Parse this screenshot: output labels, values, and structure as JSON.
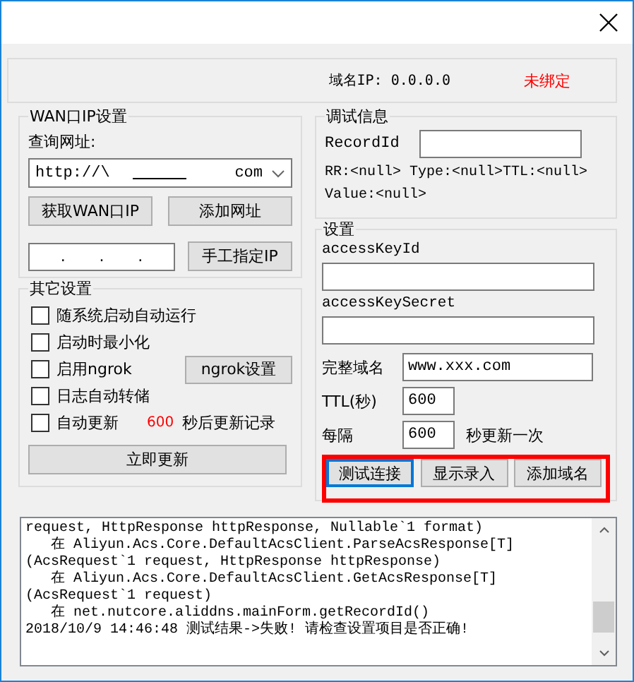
{
  "domain_ip": {
    "text": "域名IP: 0.0.0.0",
    "status": "未绑定"
  },
  "wan": {
    "title": "WAN口IP设置",
    "query_label": "查询网址:",
    "url_start": "http://\\",
    "url_end": "com",
    "buttons": [
      "获取WAN口IP",
      "添加网址"
    ],
    "ip_separators": [
      ".",
      ".",
      "."
    ],
    "manual_button": "手工指定IP"
  },
  "other": {
    "title": "其它设置",
    "options": [
      {
        "kind": "plain",
        "label": "随系统启动自动运行",
        "checked": false
      },
      {
        "kind": "plain",
        "label": "启动时最小化",
        "checked": false
      },
      {
        "kind": "button",
        "label": "启用ngrok",
        "checked": false,
        "button": "ngrok设置"
      },
      {
        "kind": "plain",
        "label": "日志自动转储",
        "checked": false
      },
      {
        "kind": "countdown",
        "label": "自动更新",
        "checked": false,
        "count": "600",
        "suffix": "秒后更新记录"
      }
    ],
    "update_button": "立即更新"
  },
  "debug": {
    "title": "调试信息",
    "record_label": "RecordId",
    "rr_line": "RR:<null> Type:<null>TTL:<null>",
    "value_line": "Value:<null>"
  },
  "settings": {
    "title": "设置",
    "rows": [
      {
        "kind": "stacked",
        "label": "accessKeyId"
      },
      {
        "kind": "stacked",
        "label": "accessKeySecret"
      },
      {
        "kind": "wide",
        "label": "完整域名",
        "value": "www.xxx.com"
      },
      {
        "kind": "short",
        "label": "TTL(秒)",
        "value": "600"
      },
      {
        "kind": "suffix",
        "label": "每隔",
        "value": "600",
        "suffix": "秒更新一次"
      }
    ],
    "buttons": [
      {
        "label": "测试连接",
        "focused": true
      },
      {
        "label": "显示录入",
        "focused": false
      },
      {
        "label": "添加域名",
        "focused": false
      }
    ]
  },
  "log": {
    "lines": [
      "request, HttpResponse httpResponse, Nullable`1 format)",
      "   在 Aliyun.Acs.Core.DefaultAcsClient.ParseAcsResponse[T]",
      "(AcsRequest`1 request, HttpResponse httpResponse)",
      "   在 Aliyun.Acs.Core.DefaultAcsClient.GetAcsResponse[T]",
      "(AcsRequest`1 request)",
      "   在 net.nutcore.aliddns.mainForm.getRecordId()",
      "2018/10/9 14:46:48 测试结果->失败! 请检查设置项目是否正确!"
    ]
  }
}
